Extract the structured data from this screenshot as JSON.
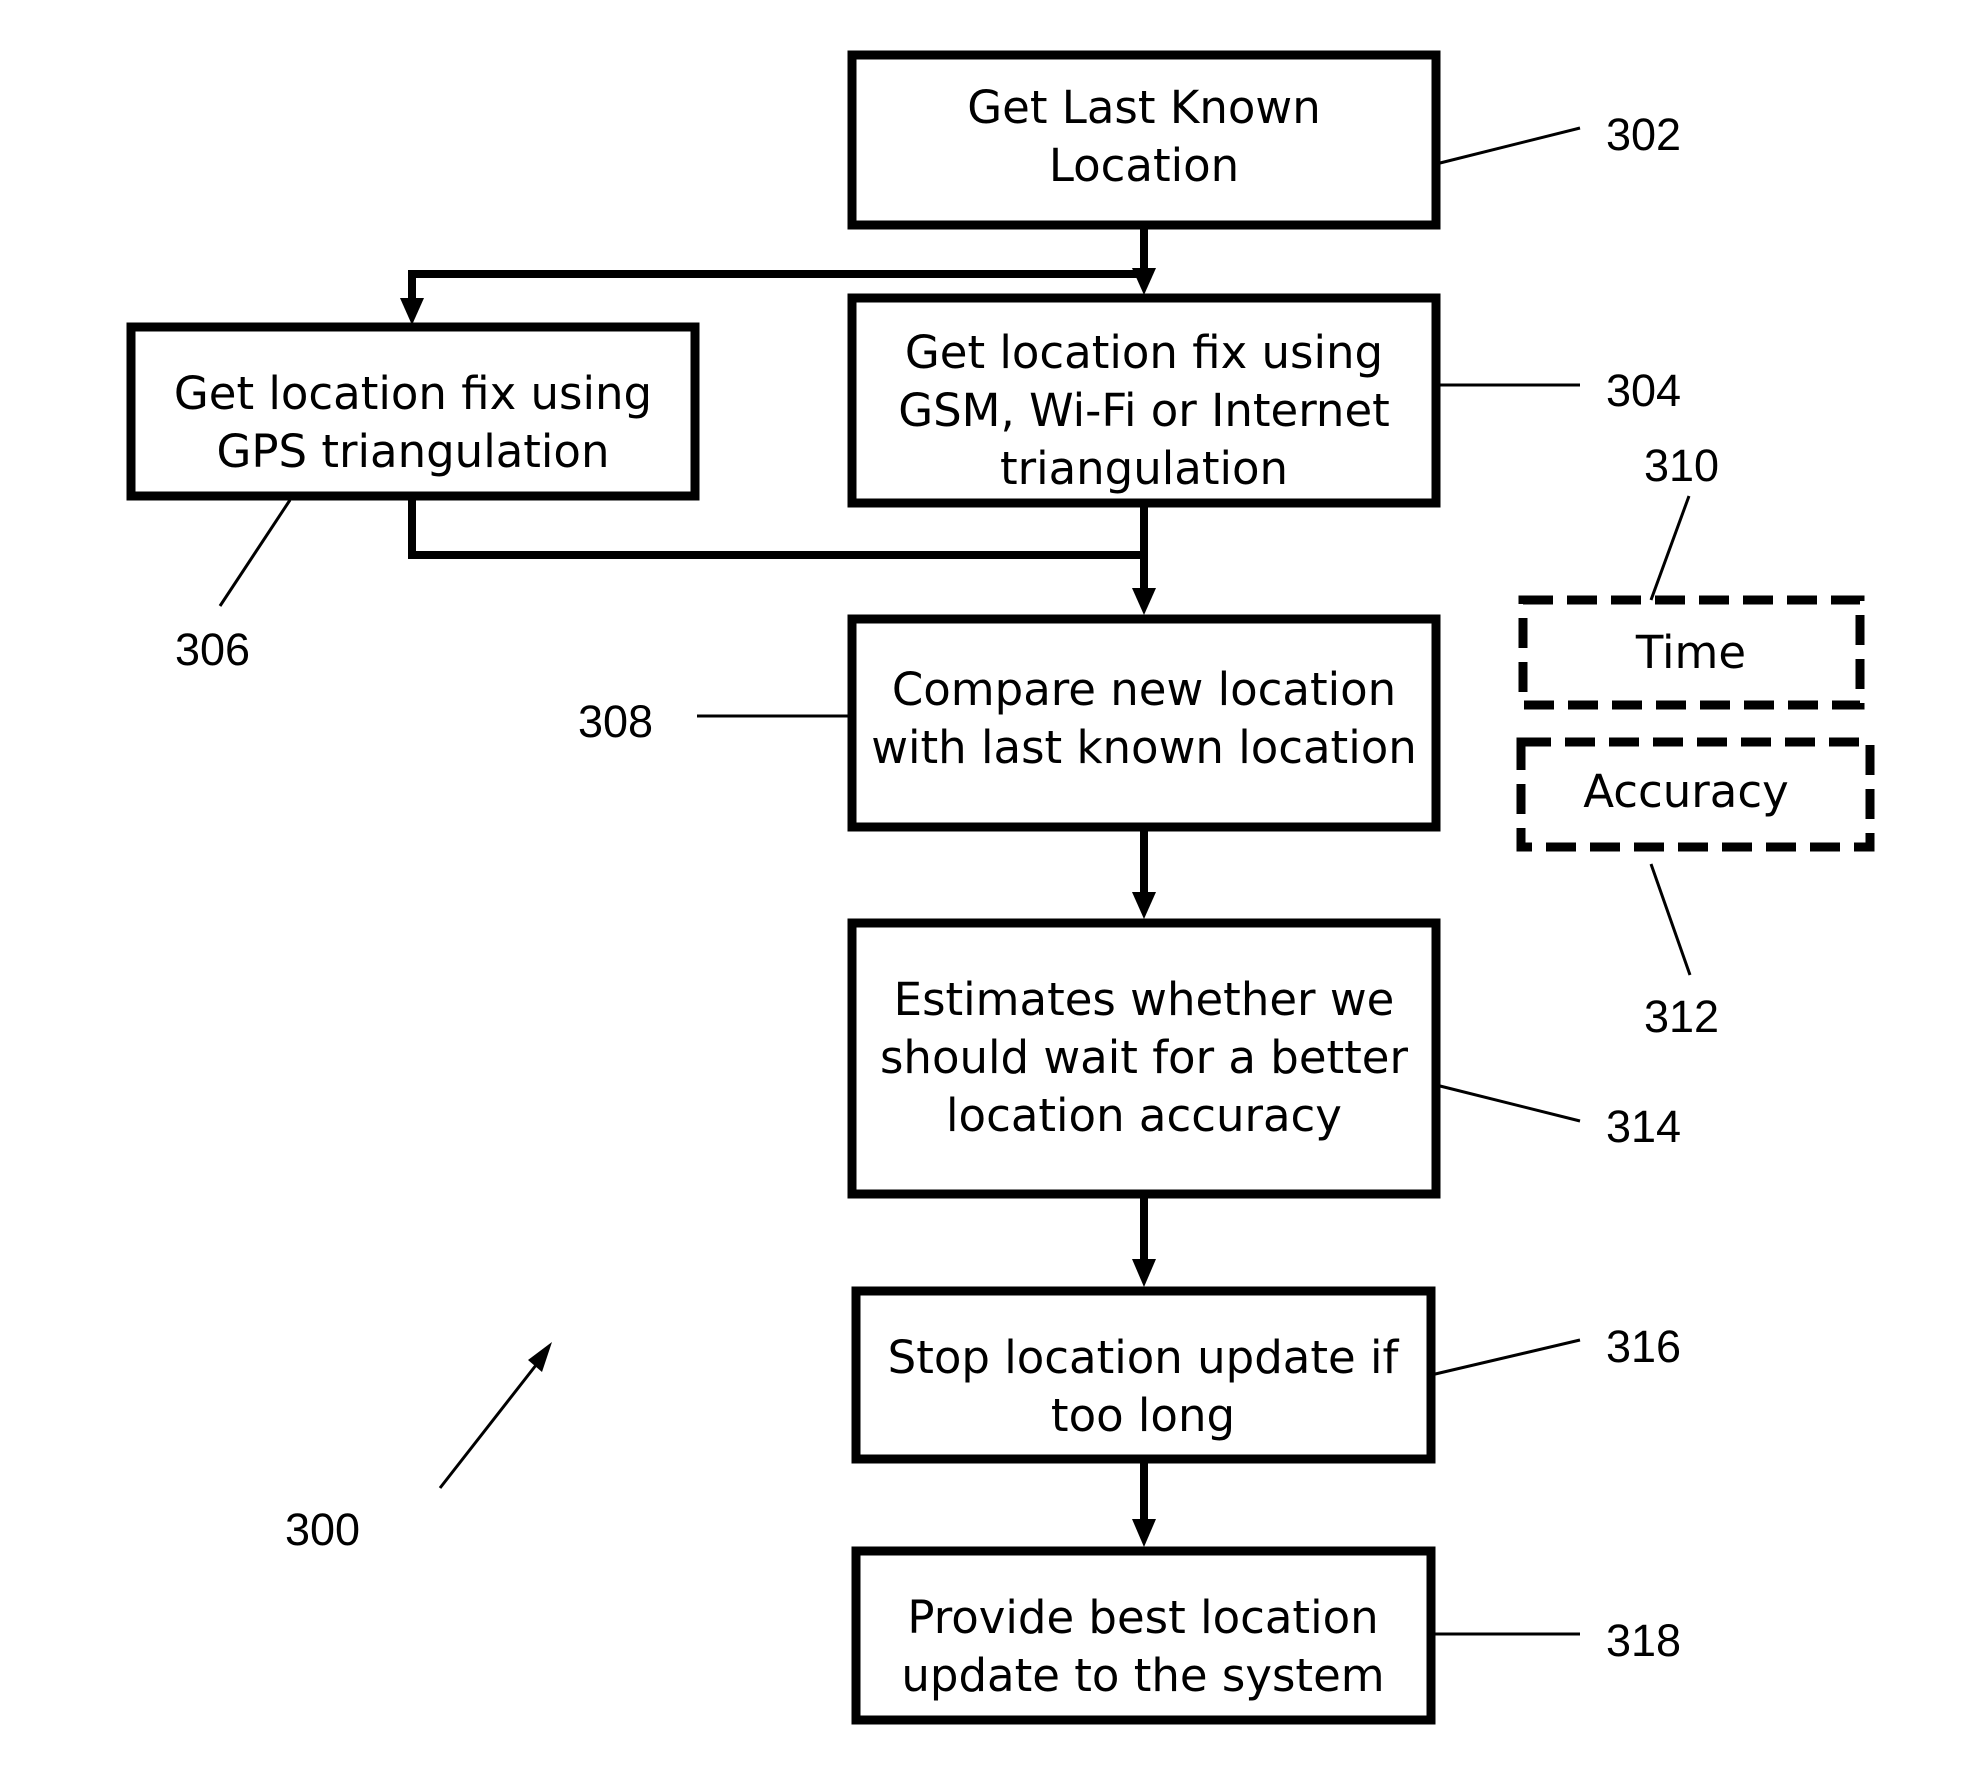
{
  "figure": {
    "reference": "300",
    "colors": {
      "stroke": "#000000",
      "background": "#ffffff"
    }
  },
  "steps": {
    "s302": {
      "ref": "302",
      "lines": [
        "Get Last Known",
        "Location"
      ]
    },
    "s304": {
      "ref": "304",
      "lines": [
        "Get location fix using",
        "GSM, Wi-Fi or Internet",
        "triangulation"
      ]
    },
    "s306": {
      "ref": "306",
      "lines": [
        "Get location fix using",
        "GPS triangulation"
      ]
    },
    "s308": {
      "ref": "308",
      "lines": [
        "Compare new location",
        "with last known location"
      ]
    },
    "s310": {
      "ref": "310",
      "lines": [
        "Time"
      ]
    },
    "s312": {
      "ref": "312",
      "lines": [
        "Accuracy"
      ]
    },
    "s314": {
      "ref": "314",
      "lines": [
        "Estimates whether we",
        "should wait for a better",
        "location accuracy"
      ]
    },
    "s316": {
      "ref": "316",
      "lines": [
        "Stop location update if",
        "too long"
      ]
    },
    "s318": {
      "ref": "318",
      "lines": [
        "Provide best location",
        "update to the system"
      ]
    }
  },
  "edges": [
    {
      "from": "302",
      "to": "304"
    },
    {
      "from": "302",
      "to": "306"
    },
    {
      "from": "304",
      "to": "308"
    },
    {
      "from": "306",
      "to": "308"
    },
    {
      "from": "308",
      "to": "314"
    },
    {
      "from": "314",
      "to": "316"
    },
    {
      "from": "316",
      "to": "318"
    }
  ]
}
